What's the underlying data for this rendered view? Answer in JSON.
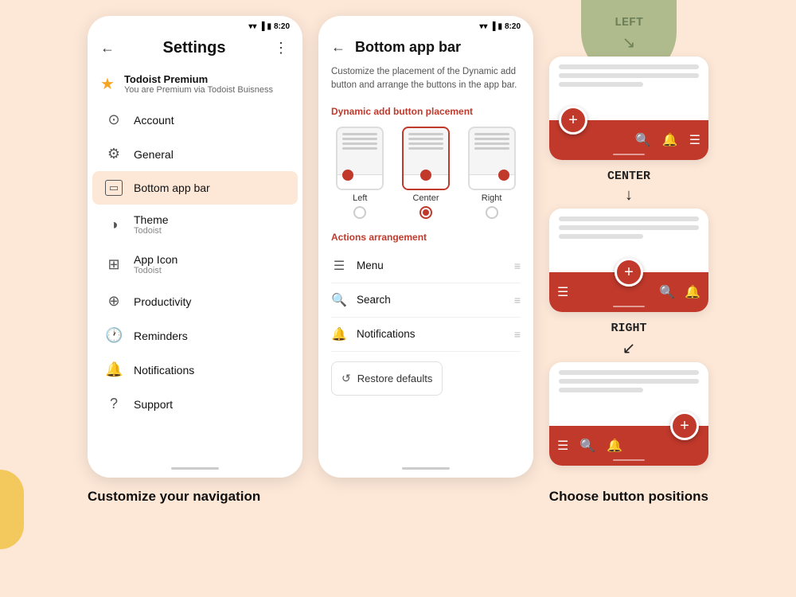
{
  "bg_color": "#fde8d8",
  "left_phone": {
    "status_time": "8:20",
    "header": {
      "title": "Settings",
      "back": "←",
      "more": "⋮"
    },
    "premium": {
      "title": "Todoist Premium",
      "subtitle": "You are Premium via Todoist Buisness"
    },
    "items": [
      {
        "id": "account",
        "icon": "👤",
        "label": "Account",
        "sublabel": ""
      },
      {
        "id": "general",
        "icon": "⚙",
        "label": "General",
        "sublabel": ""
      },
      {
        "id": "bottom-app-bar",
        "icon": "▭",
        "label": "Bottom app bar",
        "sublabel": "",
        "active": true
      },
      {
        "id": "theme",
        "icon": "🎨",
        "label": "Theme",
        "sublabel": "Todoist"
      },
      {
        "id": "app-icon",
        "icon": "📋",
        "label": "App Icon",
        "sublabel": "Todoist"
      },
      {
        "id": "productivity",
        "icon": "📊",
        "label": "Productivity",
        "sublabel": ""
      },
      {
        "id": "reminders",
        "icon": "🔔",
        "label": "Reminders",
        "sublabel": ""
      },
      {
        "id": "notifications",
        "icon": "🔔",
        "label": "Notifications",
        "sublabel": ""
      },
      {
        "id": "support",
        "icon": "❓",
        "label": "Support",
        "sublabel": ""
      }
    ]
  },
  "right_phone": {
    "status_time": "8:20",
    "header": {
      "title": "Bottom app bar",
      "back": "←"
    },
    "description": "Customize the placement of the Dynamic add button and arrange the buttons in the app bar.",
    "placement_section": "Dynamic add button placement",
    "placement_options": [
      {
        "id": "left",
        "label": "Left",
        "selected": false
      },
      {
        "id": "center",
        "label": "Center",
        "selected": true
      },
      {
        "id": "right",
        "label": "Right",
        "selected": false
      }
    ],
    "actions_section": "Actions arrangement",
    "actions": [
      {
        "id": "menu",
        "icon": "☰",
        "label": "Menu"
      },
      {
        "id": "search",
        "icon": "🔍",
        "label": "Search"
      },
      {
        "id": "notifications",
        "icon": "🔔",
        "label": "Notifications"
      }
    ],
    "restore_button": "Restore defaults"
  },
  "positions": [
    {
      "id": "left",
      "label": "LEFT",
      "position": "left",
      "bar_icons": [
        "🔍",
        "🔔",
        "☰"
      ]
    },
    {
      "id": "center",
      "label": "CENTER",
      "position": "center",
      "bar_icons_left": [
        "☰"
      ],
      "bar_icons_right": [
        "🔍",
        "🔔"
      ]
    },
    {
      "id": "right",
      "label": "RIGHT",
      "position": "right",
      "bar_icons": [
        "☰",
        "🔍",
        "🔔"
      ]
    }
  ],
  "caption_left": "Customize your navigation",
  "caption_right": "Choose button positions"
}
